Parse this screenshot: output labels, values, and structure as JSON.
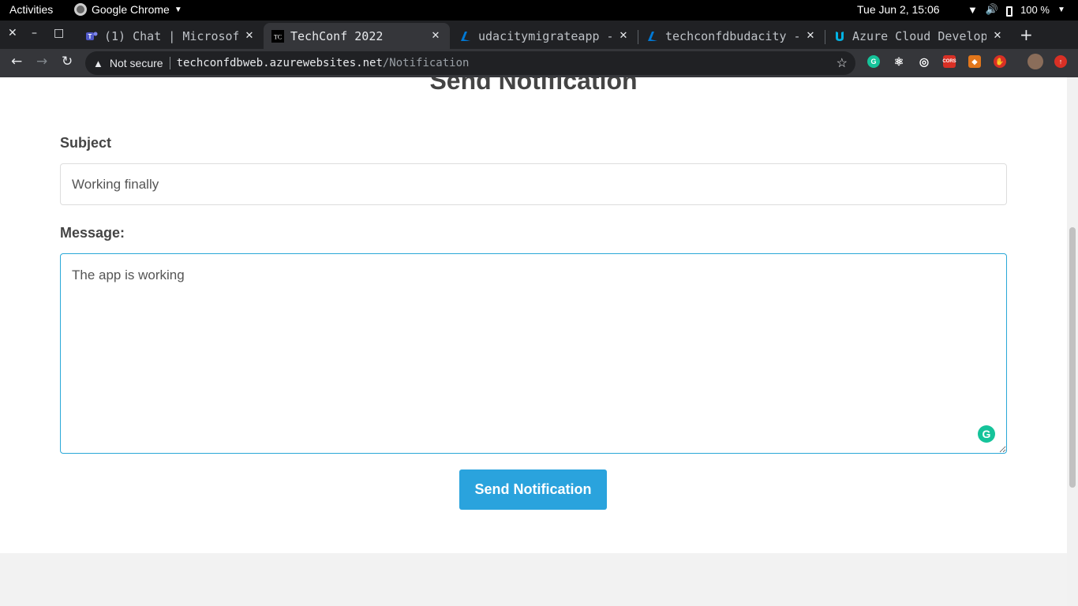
{
  "topbar": {
    "activities": "Activities",
    "app_name": "Google Chrome",
    "clock": "Tue Jun  2, 15:06",
    "battery": "100 %"
  },
  "tabs": [
    {
      "label": "(1) Chat | Microsof",
      "icon": "teams-icon",
      "active": false
    },
    {
      "label": "TechConf 2022",
      "icon": "techconf-icon",
      "active": true
    },
    {
      "label": "udacitymigrateapp - ",
      "icon": "azure-icon",
      "active": false
    },
    {
      "label": "techconfdbudacity - ",
      "icon": "azure-icon",
      "active": false
    },
    {
      "label": "Azure Cloud Develop",
      "icon": "udacity-icon",
      "active": false
    }
  ],
  "omnibox": {
    "security": "Not secure",
    "host": "techconfdbweb.azurewebsites.net",
    "path": "/Notification"
  },
  "extensions": [
    {
      "name": "grammarly-icon",
      "color": "#15c39a",
      "text": "G"
    },
    {
      "name": "react-devtools-icon",
      "color": "#35363a",
      "text": "⚛"
    },
    {
      "name": "target-icon",
      "color": "#35363a",
      "text": "◎"
    },
    {
      "name": "cors-icon",
      "color": "#d93025",
      "text": "CORS"
    },
    {
      "name": "metamask-icon",
      "color": "#e2761b",
      "text": "🦊"
    },
    {
      "name": "hand-icon",
      "color": "#d93025",
      "text": "✋"
    },
    {
      "name": "profile-avatar",
      "color": "#8a6d5a",
      "text": ""
    },
    {
      "name": "update-icon",
      "color": "#d93025",
      "text": "↑"
    }
  ],
  "page": {
    "title": "Send Notification",
    "subject_label": "Subject",
    "subject_value": "Working finally",
    "message_label": "Message:",
    "message_value": "The app is working",
    "send_label": "Send Notification"
  },
  "colors": {
    "accent": "#2aa3dd",
    "focus_border": "#2aa8d8"
  }
}
